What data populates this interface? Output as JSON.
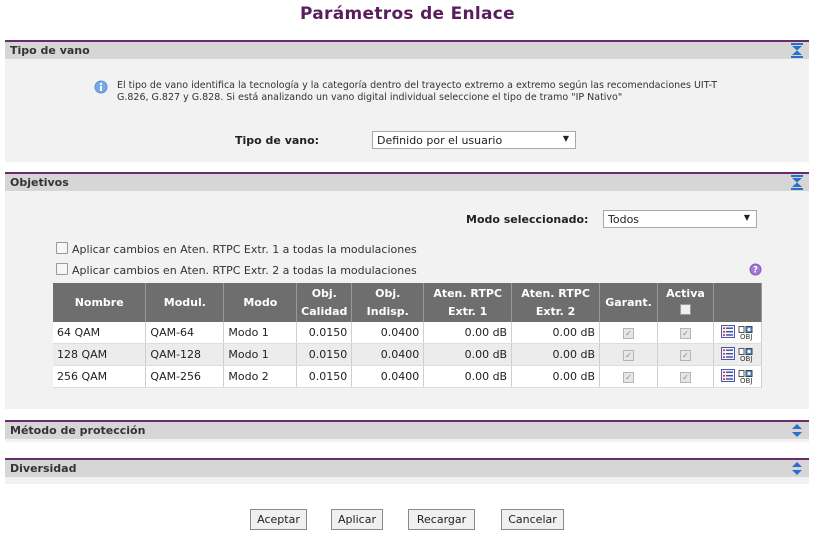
{
  "page": {
    "title": "Parámetros de Enlace"
  },
  "sections": {
    "vano": {
      "title": "Tipo de vano",
      "info": "El tipo de vano identifica la tecnología y la categoría dentro del trayecto extremo a extremo según las recomendaciones UIT-T G.826, G.827 y G.828. Si está analizando un vano digital individual seleccione el tipo de tramo \"IP Nativo\"",
      "field_label": "Tipo de vano:",
      "field_value": "Definido por el usuario"
    },
    "objetivos": {
      "title": "Objetivos",
      "mode_label": "Modo seleccionado:",
      "mode_value": "Todos",
      "check1": "Aplicar cambios en Aten. RTPC Extr. 1 a todas la modulaciones",
      "check2": "Aplicar cambios en Aten. RTPC Extr. 2 a todas la modulaciones",
      "columns": {
        "nombre": "Nombre",
        "modul": "Modul.",
        "modo": "Modo",
        "obj_cal_1": "Obj.",
        "obj_cal_2": "Calidad",
        "obj_ind_1": "Obj.",
        "obj_ind_2": "Indisp.",
        "aten1_1": "Aten. RTPC",
        "aten1_2": "Extr. 1",
        "aten2_1": "Aten. RTPC",
        "aten2_2": "Extr. 2",
        "garant": "Garant.",
        "activa": "Activa"
      },
      "rows": [
        {
          "nombre": "64 QAM",
          "modul": "QAM-64",
          "modo": "Modo 1",
          "calidad": "0.0150",
          "indisp": "0.0400",
          "aten1": "0.00 dB",
          "aten2": "0.00 dB"
        },
        {
          "nombre": "128 QAM",
          "modul": "QAM-128",
          "modo": "Modo 1",
          "calidad": "0.0150",
          "indisp": "0.0400",
          "aten1": "0.00 dB",
          "aten2": "0.00 dB"
        },
        {
          "nombre": "256 QAM",
          "modul": "QAM-256",
          "modo": "Modo 2",
          "calidad": "0.0150",
          "indisp": "0.0400",
          "aten1": "0.00 dB",
          "aten2": "0.00 dB"
        }
      ],
      "obj_icon_text": "OBJ"
    },
    "metodo": {
      "title": "Método de protección"
    },
    "diversidad": {
      "title": "Diversidad"
    }
  },
  "buttons": {
    "aceptar": "Aceptar",
    "aplicar": "Aplicar",
    "recargar": "Recargar",
    "cancelar": "Cancelar"
  },
  "colors": {
    "accent": "#6a2a6e",
    "header_bg": "#d6d6d6",
    "table_header": "#6e6e6e",
    "toggle_blue": "#2a6fc9"
  },
  "icons": [
    "collapse-icon",
    "expand-icon",
    "info-icon",
    "help-icon",
    "edit-list-icon",
    "objectives-icon"
  ]
}
